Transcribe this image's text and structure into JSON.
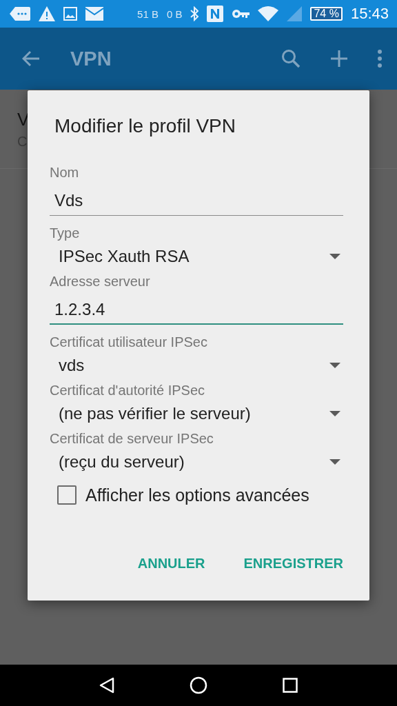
{
  "status_bar": {
    "traffic_up": "51 B",
    "traffic_down": "0 B",
    "battery": "74 %",
    "time": "15:43"
  },
  "app_bar": {
    "title": "VPN"
  },
  "list_item": {
    "title": "V",
    "subtitle": "C"
  },
  "dialog": {
    "title": "Modifier le profil VPN",
    "fields": [
      {
        "kind": "text",
        "label": "Nom",
        "value": "Vds",
        "focused": false
      },
      {
        "kind": "select",
        "label": "Type",
        "value": "IPSec Xauth RSA"
      },
      {
        "kind": "text",
        "label": "Adresse serveur",
        "value": "1.2.3.4",
        "focused": true
      },
      {
        "kind": "select",
        "label": "Certificat utilisateur IPSec",
        "value": "vds"
      },
      {
        "kind": "select",
        "label": "Certificat d'autorité IPSec",
        "value": "(ne pas vérifier le serveur)"
      },
      {
        "kind": "select",
        "label": "Certificat de serveur IPSec",
        "value": "(reçu du serveur)"
      }
    ],
    "checkbox": {
      "label": "Afficher les options avancées",
      "checked": false
    },
    "buttons": [
      "ANNULER",
      "ENREGISTRER"
    ]
  }
}
